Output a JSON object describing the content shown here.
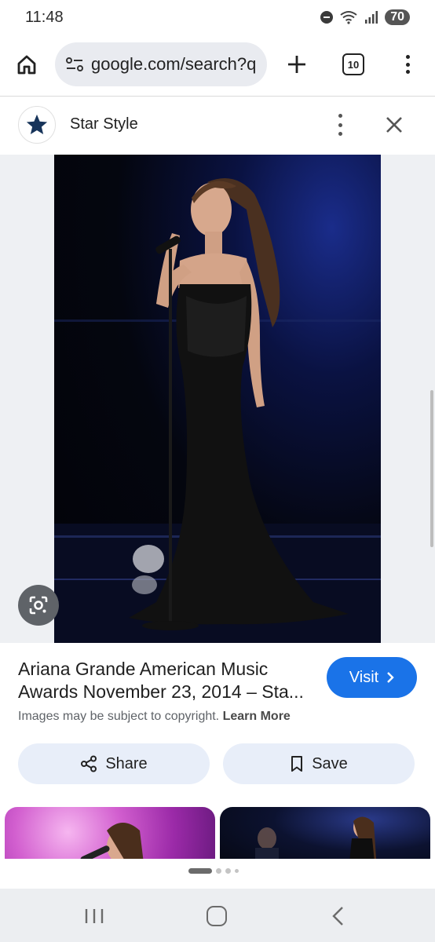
{
  "status_bar": {
    "time": "11:48",
    "battery": "70",
    "icons": [
      "do-not-disturb-icon",
      "wifi-icon",
      "signal-icon"
    ]
  },
  "browser": {
    "url": "google.com/search?q",
    "tab_count": "10",
    "icons": [
      "home-icon",
      "site-settings-icon",
      "new-tab-icon",
      "tab-switcher-icon",
      "more-vert-icon"
    ]
  },
  "source": {
    "name": "Star Style",
    "logo_icon": "star-icon"
  },
  "result": {
    "title": "Ariana Grande American Music Awards November 23, 2014 – Sta...",
    "visit_label": "Visit",
    "copyright_text": "Images may be subject to copyright.",
    "learn_more_label": "Learn More"
  },
  "actions": {
    "share_label": "Share",
    "save_label": "Save"
  },
  "colors": {
    "accent": "#1a73e8",
    "action_bg": "#e8eef9",
    "url_bg": "#e9ebf0"
  }
}
